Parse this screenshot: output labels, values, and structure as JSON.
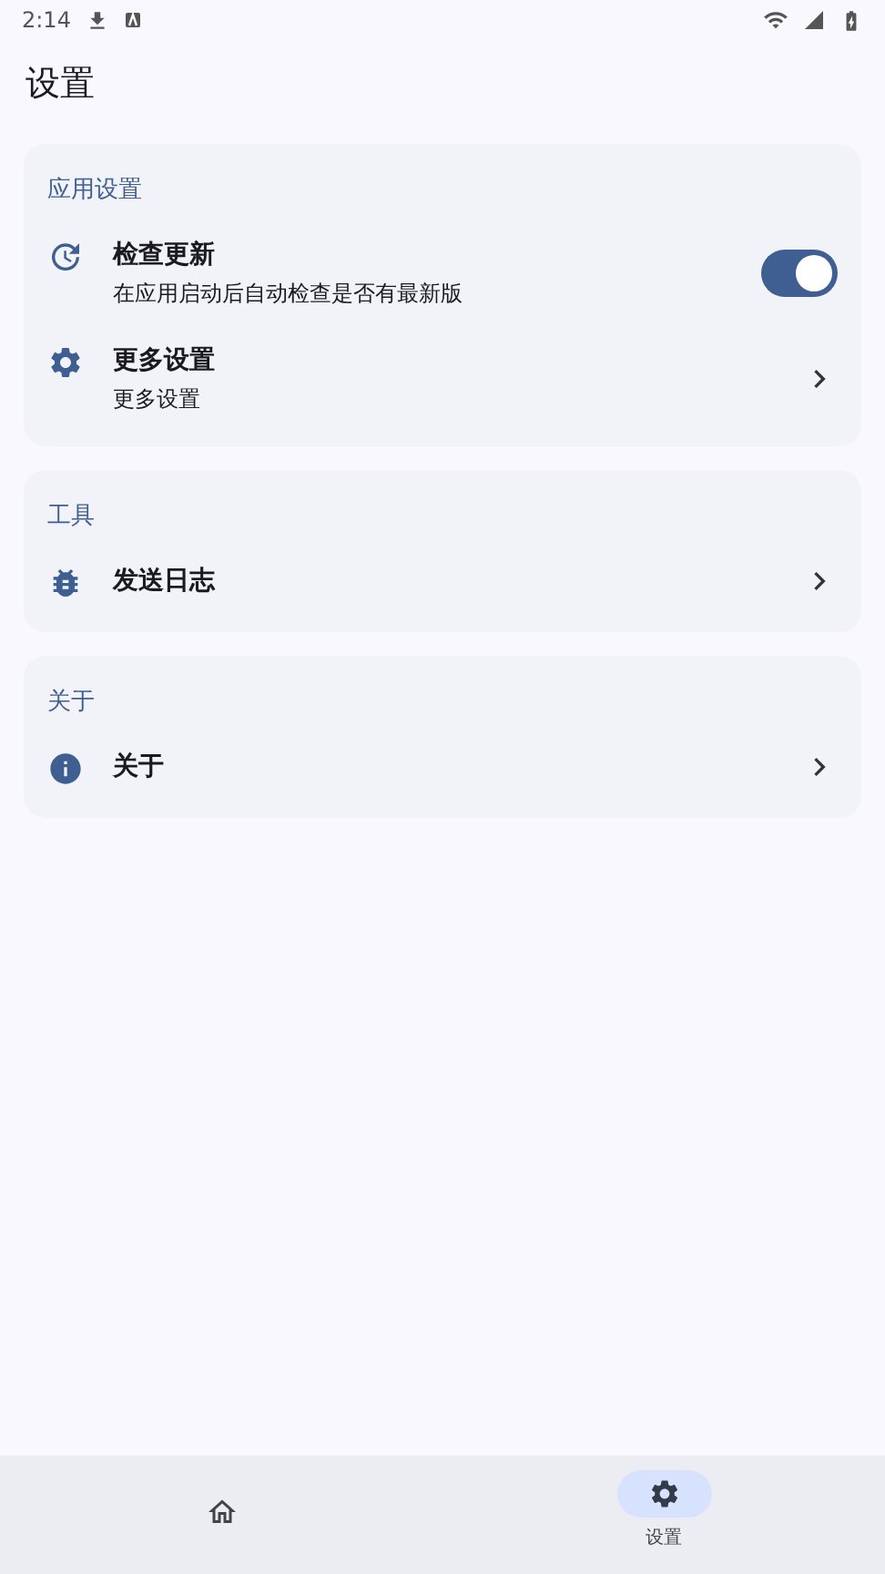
{
  "status_bar": {
    "time": "2:14"
  },
  "title": "设置",
  "sections": [
    {
      "title": "应用设置",
      "items": [
        {
          "kind": "switch",
          "label": "检查更新",
          "subtitle": "在应用启动后自动检查是否有最新版",
          "on": true
        },
        {
          "kind": "link",
          "label": "更多设置",
          "subtitle": "更多设置"
        }
      ]
    },
    {
      "title": "工具",
      "items": [
        {
          "kind": "link",
          "label": "发送日志"
        }
      ]
    },
    {
      "title": "关于",
      "items": [
        {
          "kind": "link",
          "label": "关于"
        }
      ]
    }
  ],
  "nav": [
    {
      "selected": false
    },
    {
      "label": "设置",
      "selected": true
    }
  ]
}
